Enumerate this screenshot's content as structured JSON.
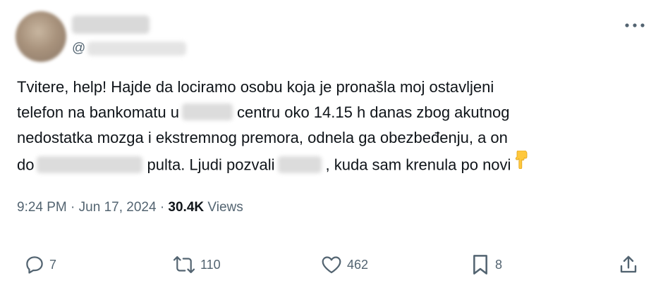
{
  "author": {
    "handle_prefix": "@"
  },
  "tweet": {
    "line1": "Tvitere, help! Hajde da lociramo osobu koja je pronašla moj ostavljeni",
    "line2_a": "telefon na bankomatu u",
    "line2_b": "centru oko 14.15 h danas zbog akutnog",
    "line3": "nedostatka mozga i ekstremnog premora, odnela ga obezbeđenju, a on",
    "line4_a": "do",
    "line4_b": "pulta. Ljudi pozvali",
    "line4_c": ", kuda sam krenula po novi",
    "emoji": "👇"
  },
  "meta": {
    "time": "9:24 PM",
    "separator": "·",
    "date": "Jun 17, 2024",
    "views_count": "30.4K",
    "views_label": "Views"
  },
  "actions": {
    "replies": "7",
    "reposts": "110",
    "likes": "462",
    "bookmarks": "8"
  },
  "icons": {
    "more": "more-horizontal-icon",
    "reply": "reply-icon",
    "repost": "repost-icon",
    "like": "heart-icon",
    "bookmark": "bookmark-icon",
    "share": "share-icon"
  },
  "colors": {
    "text": "#0f1419",
    "secondary": "#536471",
    "emoji": "#ffc83d"
  }
}
